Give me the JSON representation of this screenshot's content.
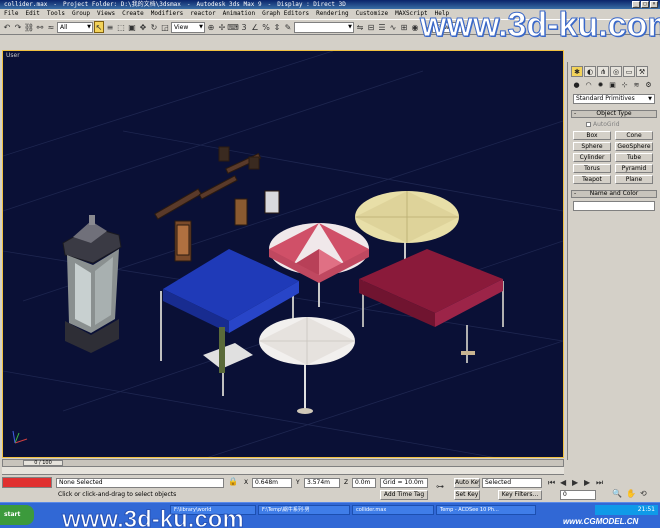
{
  "titlebar": {
    "file": "collider.max",
    "project": "Project Folder: D:\\我的文档\\3dsmax",
    "app": "Autodesk 3ds Max 9",
    "display": "Display : Direct 3D"
  },
  "menu": [
    "File",
    "Edit",
    "Tools",
    "Group",
    "Views",
    "Create",
    "Modifiers",
    "reactor",
    "Animation",
    "Graph Editors",
    "Rendering",
    "Customize",
    "MAXScript",
    "Help"
  ],
  "toolbar": {
    "selection_filter": "All",
    "reference_coord": "View",
    "named_selection": "",
    "view_drop": "View"
  },
  "watermark": "www.3d-ku.com",
  "viewport": {
    "label": "User",
    "colors": {
      "bg": "#0a1036",
      "blue_tent": "#1f3ab8",
      "red_tent": "#8a1a3a",
      "umbrella_red": "#d05068",
      "umbrella_cream": "#e8dfa8",
      "umbrella_white": "#f2f0ee"
    }
  },
  "command_panel": {
    "tabs": [
      "create-tab",
      "modify-tab",
      "hierarchy-tab",
      "motion-tab",
      "display-tab",
      "utilities-tab"
    ],
    "category": "Standard Primitives",
    "object_type_title": "Object Type",
    "autogrid": "AutoGrid",
    "objects": [
      "Box",
      "Cone",
      "Sphere",
      "GeoSphere",
      "Cylinder",
      "Tube",
      "Torus",
      "Pyramid",
      "Teapot",
      "Plane"
    ],
    "name_color_title": "Name and Color"
  },
  "timeslider": {
    "label": "0 / 100"
  },
  "status": {
    "selected": "None Selected",
    "prompt": "Click or click-and-drag to select objects",
    "x_value": "0.648m",
    "y_value": "3.574m",
    "z_value": "0.0m",
    "grid": "Grid = 10.0m",
    "add_time_tag": "Add Time Tag",
    "auto_key": "Auto Key",
    "set_key": "Set Key",
    "key_mode": "Selected",
    "key_filters": "Key Filters...",
    "frame": "0"
  },
  "taskbar": {
    "start": "start",
    "items": [
      "F:\\library\\world",
      "F:\\Temp\\蜗牛系列-男",
      "collider.max",
      "Temp - ACDSee 10 Ph..."
    ],
    "time": "21:51",
    "watermark_big": "www.3d-ku.com",
    "watermark_small": "www.CGMODEL.CN"
  }
}
